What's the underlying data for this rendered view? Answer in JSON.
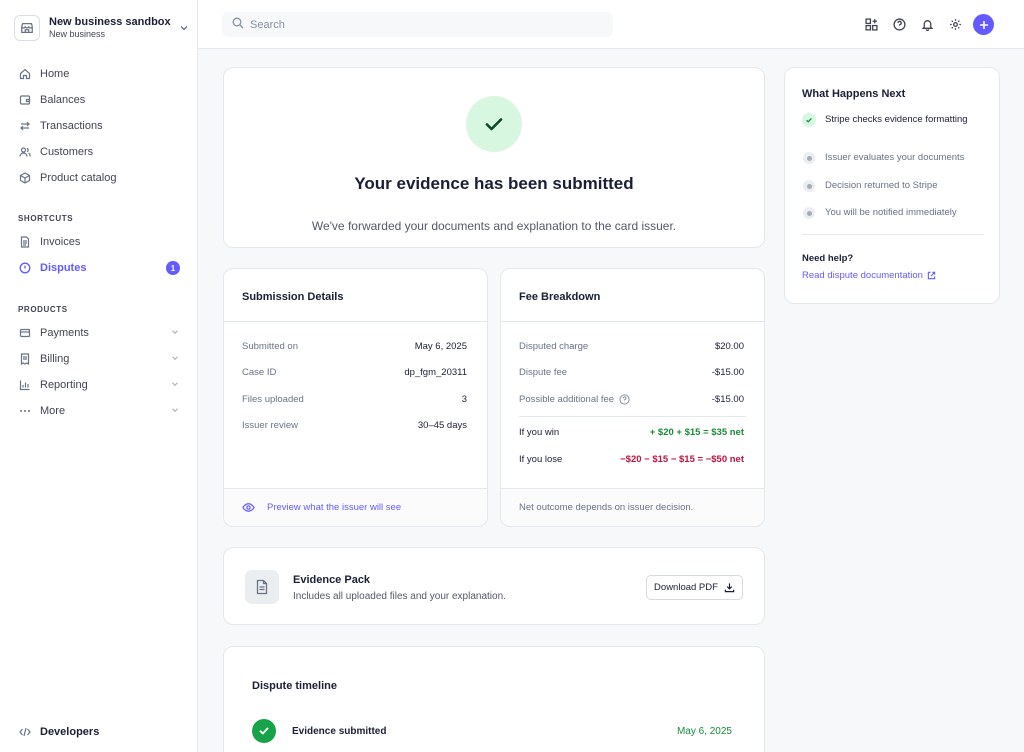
{
  "account": {
    "name": "New business sandbox",
    "sub": "New business"
  },
  "nav": {
    "main": [
      {
        "label": "Home",
        "icon": "home-icon"
      },
      {
        "label": "Balances",
        "icon": "wallet-icon"
      },
      {
        "label": "Transactions",
        "icon": "arrows-icon"
      },
      {
        "label": "Customers",
        "icon": "users-icon"
      },
      {
        "label": "Product catalog",
        "icon": "box-icon"
      }
    ],
    "shortcuts_heading": "SHORTCUTS",
    "shortcuts": [
      {
        "label": "Invoices",
        "icon": "document-icon"
      },
      {
        "label": "Disputes",
        "icon": "alert-circle-icon",
        "badge": "1"
      }
    ],
    "products_heading": "PRODUCTS",
    "products": [
      {
        "label": "Payments",
        "icon": "card-icon"
      },
      {
        "label": "Billing",
        "icon": "receipt-icon"
      },
      {
        "label": "Reporting",
        "icon": "bar-chart-icon"
      },
      {
        "label": "More",
        "icon": "ellipsis-icon"
      }
    ],
    "developers": "Developers"
  },
  "search": {
    "placeholder": "Search"
  },
  "colors": {
    "accent": "#635bff",
    "success": "#1a8a3a",
    "danger": "#c0123c"
  },
  "hero": {
    "title": "Your evidence has been submitted",
    "subtitle": "We've forwarded your documents and explanation to the card issuer."
  },
  "submission": {
    "title": "Submission Details",
    "rows": [
      {
        "k": "Submitted on",
        "v": "May 6, 2025"
      },
      {
        "k": "Case ID",
        "v": "dp_fgm_20311"
      },
      {
        "k": "Files uploaded",
        "v": "3"
      },
      {
        "k": "Issuer review",
        "v": "30–45 days"
      }
    ],
    "footer_link": "Preview what the issuer will see"
  },
  "fees": {
    "title": "Fee Breakdown",
    "rows": [
      {
        "k": "Disputed charge",
        "v": "$20.00"
      },
      {
        "k": "Dispute fee",
        "v": "-$15.00"
      },
      {
        "k": "Possible additional fee",
        "v": "-$15.00"
      }
    ],
    "win_label": "If you win",
    "win_value": "+ $20 + $15 = $35 net",
    "lose_label": "If you lose",
    "lose_value": "−$20 − $15 − $15 = −$50 net",
    "footer": "Net outcome depends on issuer decision."
  },
  "evidence_pack": {
    "title": "Evidence Pack",
    "subtitle": "Includes all uploaded files and your explanation.",
    "button": "Download PDF"
  },
  "timeline": {
    "title": "Dispute timeline",
    "items": [
      {
        "label": "Evidence submitted",
        "date": "May 6, 2025"
      }
    ]
  },
  "next": {
    "title": "What Happens Next",
    "steps": [
      {
        "text": "Stripe checks evidence formatting",
        "done": true
      },
      {
        "text": "Issuer evaluates your documents",
        "done": false
      },
      {
        "text": "Decision returned to Stripe",
        "done": false
      },
      {
        "text": "You will be notified immediately",
        "done": false
      }
    ],
    "help_title": "Need help?",
    "help_link": "Read dispute documentation"
  }
}
